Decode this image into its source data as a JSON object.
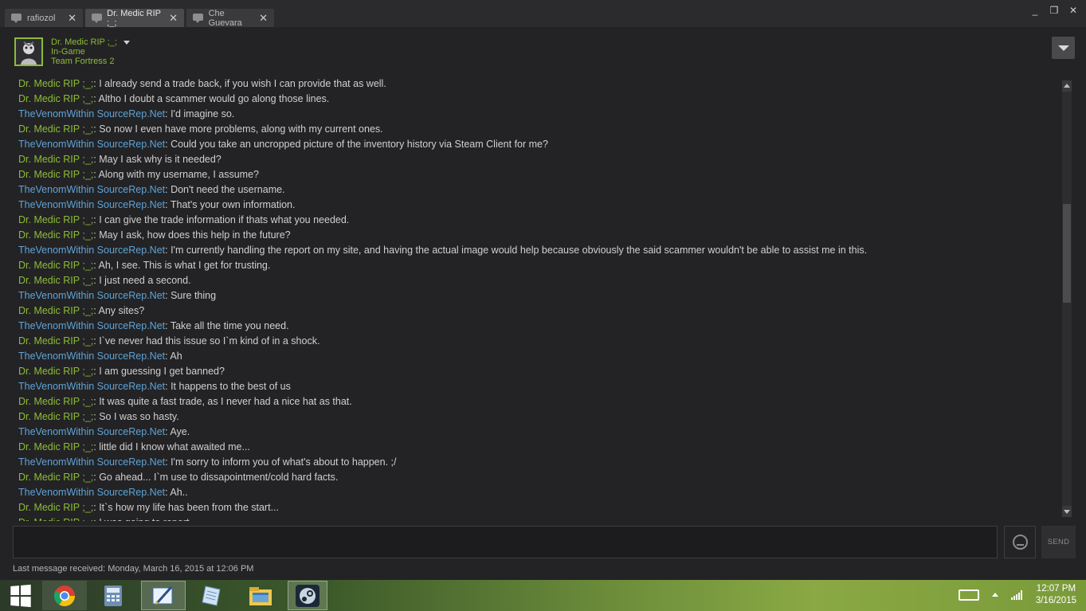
{
  "tabs": [
    {
      "label": "rafiozol",
      "active": false
    },
    {
      "label": "Dr. Medic RIP ;_;",
      "active": true
    },
    {
      "label": "Che Guevara",
      "active": false
    }
  ],
  "tab_close_glyph": "✕",
  "window_controls": {
    "minimize": "_",
    "restore": "❐",
    "close": "✕"
  },
  "friend": {
    "name": "Dr. Medic RIP ;_;",
    "status": "In-Game",
    "game": "Team Fortress 2"
  },
  "messages": [
    {
      "sender": "Dr. Medic RIP ;_;",
      "role": "medic",
      "text": "I already send a trade back, if you wish I can provide that as well."
    },
    {
      "sender": "Dr. Medic RIP ;_;",
      "role": "medic",
      "text": "Altho I doubt a scammer would go along those lines."
    },
    {
      "sender": "TheVenomWithin SourceRep.Net",
      "role": "venom",
      "text": "I'd imagine so."
    },
    {
      "sender": "Dr. Medic RIP ;_;",
      "role": "medic",
      "text": "So now I even have more problems, along with my current ones."
    },
    {
      "sender": "TheVenomWithin SourceRep.Net",
      "role": "venom",
      "text": "Could you take an uncropped picture of the inventory history via Steam Client for me?"
    },
    {
      "sender": "Dr. Medic RIP ;_;",
      "role": "medic",
      "text": "May I ask why is it needed?"
    },
    {
      "sender": "Dr. Medic RIP ;_;",
      "role": "medic",
      "text": "Along with my username, I assume?"
    },
    {
      "sender": "TheVenomWithin SourceRep.Net",
      "role": "venom",
      "text": "Don't need the username."
    },
    {
      "sender": "TheVenomWithin SourceRep.Net",
      "role": "venom",
      "text": "That's your own information."
    },
    {
      "sender": "Dr. Medic RIP ;_;",
      "role": "medic",
      "text": "I can give the trade information if thats what you needed."
    },
    {
      "sender": "Dr. Medic RIP ;_;",
      "role": "medic",
      "text": "May I ask, how does this help in the future?"
    },
    {
      "sender": "TheVenomWithin SourceRep.Net",
      "role": "venom",
      "text": "I'm currently handling the report on my site, and having the actual image would help because obviously the said scammer wouldn't be able to assist me in this."
    },
    {
      "sender": "Dr. Medic RIP ;_;",
      "role": "medic",
      "text": "Ah, I see. This is what I get for trusting."
    },
    {
      "sender": "Dr. Medic RIP ;_;",
      "role": "medic",
      "text": "I just need a second."
    },
    {
      "sender": "TheVenomWithin SourceRep.Net",
      "role": "venom",
      "text": "Sure thing"
    },
    {
      "sender": "Dr. Medic RIP ;_;",
      "role": "medic",
      "text": "Any sites?"
    },
    {
      "sender": "TheVenomWithin SourceRep.Net",
      "role": "venom",
      "text": "Take all the time you need."
    },
    {
      "sender": "Dr. Medic RIP ;_;",
      "role": "medic",
      "text": "I`ve never had this issue so I`m kind of in a shock."
    },
    {
      "sender": "TheVenomWithin SourceRep.Net",
      "role": "venom",
      "text": "Ah"
    },
    {
      "sender": "Dr. Medic RIP ;_;",
      "role": "medic",
      "text": "I am guessing I get banned?"
    },
    {
      "sender": "TheVenomWithin SourceRep.Net",
      "role": "venom",
      "text": "It happens to the best of us"
    },
    {
      "sender": "Dr. Medic RIP ;_;",
      "role": "medic",
      "text": "It was quite a fast trade, as I never had a nice hat as that."
    },
    {
      "sender": "Dr. Medic RIP ;_;",
      "role": "medic",
      "text": "So I was so hasty."
    },
    {
      "sender": "TheVenomWithin SourceRep.Net",
      "role": "venom",
      "text": "Aye."
    },
    {
      "sender": "Dr. Medic RIP ;_;",
      "role": "medic",
      "text": "little did I know what awaited me..."
    },
    {
      "sender": "TheVenomWithin SourceRep.Net",
      "role": "venom",
      "text": "I'm sorry to inform you of what's about to happen. ;/"
    },
    {
      "sender": "Dr. Medic RIP ;_;",
      "role": "medic",
      "text": "Go ahead... I`m use to dissapointment/cold hard facts."
    },
    {
      "sender": "TheVenomWithin SourceRep.Net",
      "role": "venom",
      "text": "Ah.."
    },
    {
      "sender": "Dr. Medic RIP ;_;",
      "role": "medic",
      "text": "It`s how my life has been from the start..."
    },
    {
      "sender": "Dr. Medic RIP ;_;",
      "role": "medic",
      "text": "I was going to report..."
    }
  ],
  "input": {
    "value": "",
    "placeholder": ""
  },
  "send_label": "SEND",
  "last_message": "Last message received: Monday, March 16, 2015 at 12:06 PM",
  "colors": {
    "medic": "#8dbb38",
    "venom": "#5fa3d6",
    "text": "#d0d0d0",
    "background": "#232325"
  },
  "taskbar": {
    "items": [
      "start-icon",
      "chrome-icon",
      "calculator-icon",
      "paint-icon",
      "notepad-icon",
      "file-explorer-icon",
      "steam-icon"
    ],
    "active": "paint-icon",
    "clock_time": "12:07 PM",
    "clock_date": "3/16/2015"
  }
}
